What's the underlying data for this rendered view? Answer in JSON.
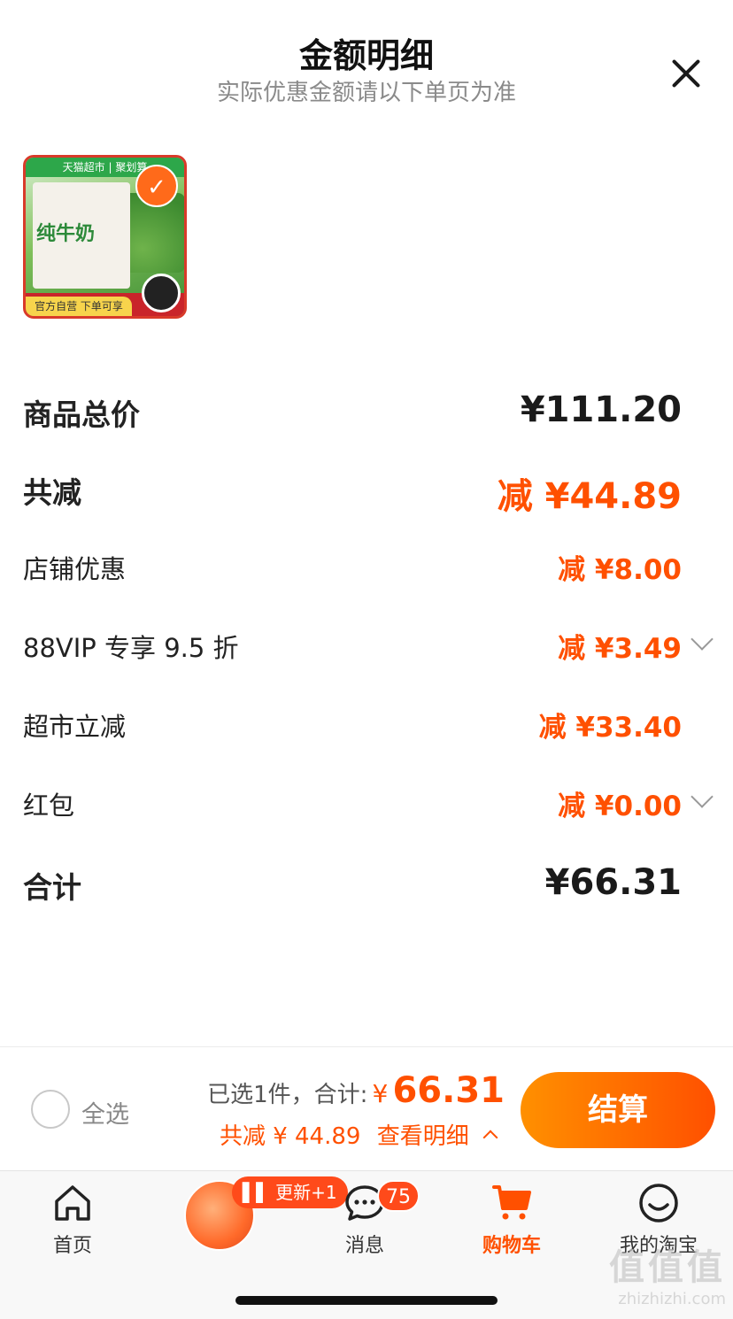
{
  "sheet": {
    "title": "金额明细",
    "subtitle": "实际优惠金额请以下单页为准"
  },
  "product": {
    "banner": "天猫超市 | 聚划算",
    "box_label": "纯牛奶",
    "footer_label": "官方自营 下单可享",
    "selected": true
  },
  "rows": [
    {
      "label": "商品总价",
      "value": "¥111.20"
    },
    {
      "label": "共减",
      "value": "减 ¥44.89"
    },
    {
      "label": "店铺优惠",
      "value": "减 ¥8.00"
    },
    {
      "label": "88VIP 专享 9.5 折",
      "value": "减 ¥3.49",
      "expandable": true
    },
    {
      "label": "超市立减",
      "value": "减 ¥33.40"
    },
    {
      "label": "红包",
      "value": "减 ¥0.00",
      "expandable": true
    },
    {
      "label": "合计",
      "value": "¥66.31"
    }
  ],
  "checkout_bar": {
    "select_all": "全选",
    "selected_text": "已选1件，合计:",
    "currency": "¥",
    "total": "66.31",
    "discount_text": "共减 ¥ 44.89",
    "view_detail": "查看明细",
    "checkout_button": "结算"
  },
  "tabbar": {
    "home": "首页",
    "avatar_badge": "更新+1",
    "messages": "消息",
    "messages_count": "75",
    "cart": "购物车",
    "profile": "我的淘宝"
  },
  "watermark": {
    "logo": "值值值",
    "url": "zhizhizhi.com"
  },
  "colors": {
    "accent": "#ff5000",
    "checkout_gradient_start": "#ff9000",
    "checkout_gradient_end": "#ff5000"
  },
  "icons": [
    "close-icon",
    "check-icon",
    "chevron-down-icon",
    "chevron-up-icon",
    "home-icon",
    "message-icon",
    "cart-icon",
    "smiley-icon"
  ]
}
